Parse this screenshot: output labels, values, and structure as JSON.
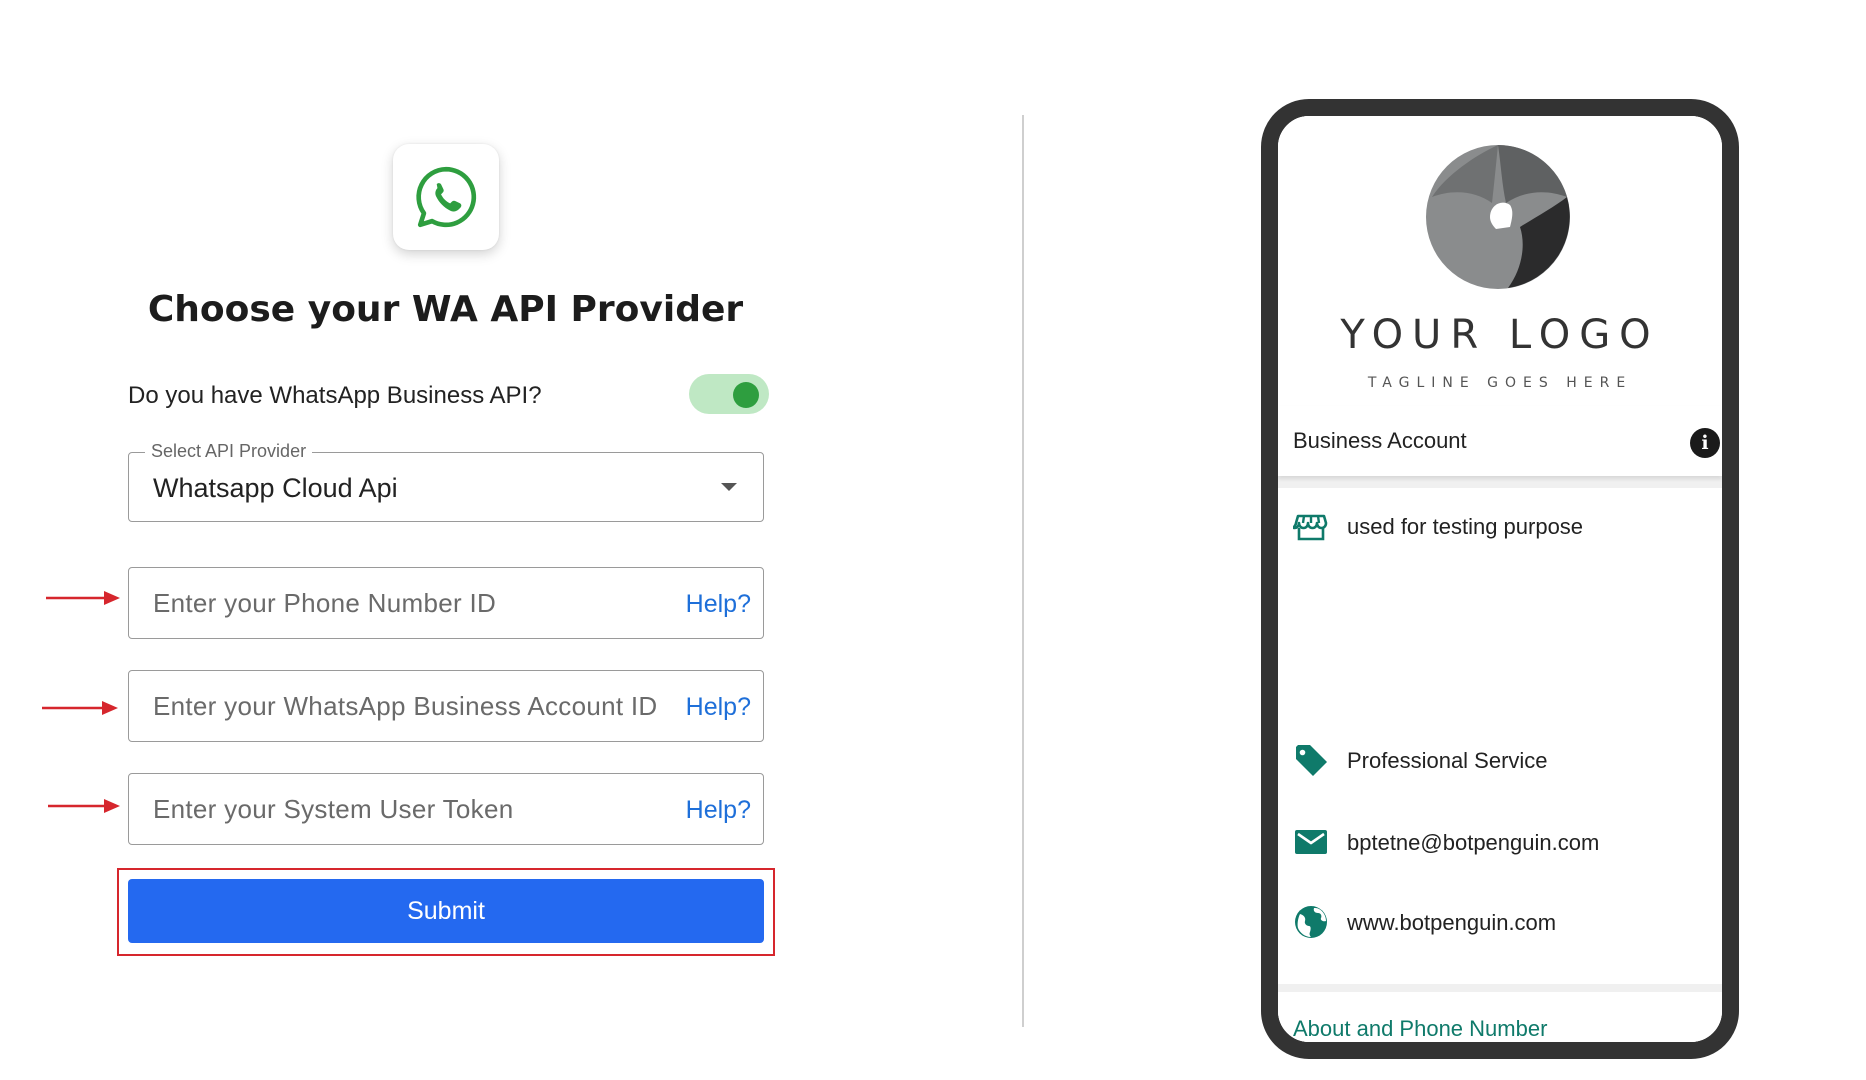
{
  "provider_form": {
    "title": "Choose your WA API Provider",
    "toggle_label": "Do you have WhatsApp Business API?",
    "toggle_on": true,
    "select_legend": "Select API Provider",
    "select_value": "Whatsapp Cloud Api",
    "fields": [
      {
        "placeholder": "Enter your Phone Number ID",
        "help": "Help?"
      },
      {
        "placeholder": "Enter your WhatsApp Business Account ID",
        "help": "Help?"
      },
      {
        "placeholder": "Enter your System User Token",
        "help": "Help?"
      }
    ],
    "submit_label": "Submit"
  },
  "preview": {
    "logo_text": "YOUR LOGO",
    "tagline": "TAGLINE GOES HERE",
    "account_title": "Business Account",
    "info_glyph": "i",
    "description": "used for testing purpose",
    "category": "Professional Service",
    "email": "bptetne@botpenguin.com",
    "website": "www.botpenguin.com",
    "about_link": "About and Phone Number"
  },
  "colors": {
    "primary": "#2469f0",
    "highlight": "#d6262d",
    "whatsapp_green": "#2e9e3f",
    "teal_icon": "#0f7a6a",
    "link_blue": "#1e6fd9"
  },
  "icons": {
    "wa_logo": "whatsapp-icon",
    "store": "store-icon",
    "tag": "tag-icon",
    "mail": "mail-icon",
    "globe": "globe-icon",
    "info": "info-icon",
    "caret": "chevron-down-icon",
    "arrow": "arrow-right-icon"
  }
}
